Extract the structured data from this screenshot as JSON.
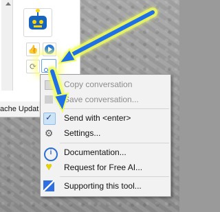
{
  "status_bar": {
    "text": "ache Updat"
  },
  "menu": {
    "items": [
      {
        "label": "Copy conversation",
        "icon": "copy-icon",
        "disabled": true
      },
      {
        "label": "Save conversation...",
        "icon": "save-icon",
        "disabled": true
      },
      {
        "label": "Send with <enter>",
        "icon": "check-icon",
        "checked": true
      },
      {
        "label": "Settings...",
        "icon": "gear-icon"
      },
      {
        "label": "Documentation...",
        "icon": "info-icon"
      },
      {
        "label": "Request for Free AI...",
        "icon": "heart-icon"
      },
      {
        "label": "Supporting this tool...",
        "icon": "support-icon"
      }
    ]
  },
  "colors": {
    "accent_blue": "#1e73d8",
    "highlight_yellow": "#f2ff5a",
    "arrow_blue": "#1f6fe6"
  }
}
